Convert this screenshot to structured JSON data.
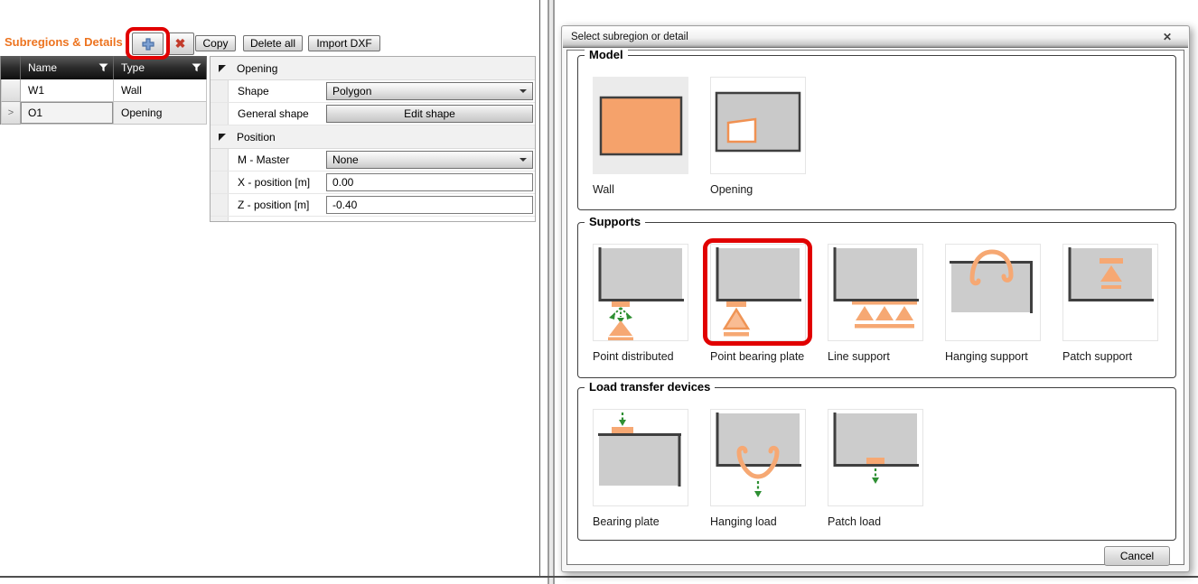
{
  "colors": {
    "accent_orange": "#ED7420",
    "annotation_red": "#E10000",
    "icon_orange": "#F6A873",
    "icon_orange_stroke": "#EF9455",
    "wall_fill_orange": "#F5A26B",
    "icon_gray": "#CCCCCC",
    "icon_dark_edge": "#3F3F3F",
    "arrow_green": "#2E8F33"
  },
  "left_panel": {
    "title": "Subregions & Details",
    "toolbar": {
      "add_icon": "plus-icon",
      "delete_icon": "red-x-icon",
      "delete_glyph": "✖",
      "copy": "Copy",
      "delete_all": "Delete all",
      "import_dxf": "Import DXF"
    },
    "table": {
      "columns": [
        "Name",
        "Type"
      ],
      "filter_icon": "funnel-icon",
      "current_row_marker": ">",
      "rows": [
        {
          "name": "W1",
          "type": "Wall",
          "selected": false
        },
        {
          "name": "O1",
          "type": "Opening",
          "selected": true
        }
      ]
    },
    "property_groups": [
      {
        "title": "Opening",
        "rows": [
          {
            "label": "Shape",
            "editor": "dropdown",
            "value": "Polygon"
          },
          {
            "label": "General shape",
            "editor": "button",
            "value": "Edit shape"
          }
        ]
      },
      {
        "title": "Position",
        "rows": [
          {
            "label": "M - Master",
            "editor": "dropdown",
            "value": "None"
          },
          {
            "label": "X - position [m]",
            "editor": "text",
            "value": "0.00"
          },
          {
            "label": "Z - position [m]",
            "editor": "text",
            "value": "-0.40"
          }
        ]
      }
    ]
  },
  "dialog": {
    "title": "Select subregion or detail",
    "close_glyph": "✕",
    "cancel_label": "Cancel",
    "groups": [
      {
        "title": "Model",
        "items": [
          {
            "label": "Wall",
            "icon": "wall-icon",
            "selected": true
          },
          {
            "label": "Opening",
            "icon": "opening-icon"
          }
        ]
      },
      {
        "title": "Supports",
        "items": [
          {
            "label": "Point distributed",
            "icon": "point-distributed-icon"
          },
          {
            "label": "Point bearing plate",
            "icon": "point-bearing-plate-icon",
            "annotated": true
          },
          {
            "label": "Line support",
            "icon": "line-support-icon"
          },
          {
            "label": "Hanging support",
            "icon": "hanging-support-icon"
          },
          {
            "label": "Patch support",
            "icon": "patch-support-icon"
          }
        ]
      },
      {
        "title": "Load transfer devices",
        "items": [
          {
            "label": "Bearing plate",
            "icon": "bearing-plate-icon"
          },
          {
            "label": "Hanging load",
            "icon": "hanging-load-icon"
          },
          {
            "label": "Patch load",
            "icon": "patch-load-icon"
          }
        ]
      }
    ]
  }
}
